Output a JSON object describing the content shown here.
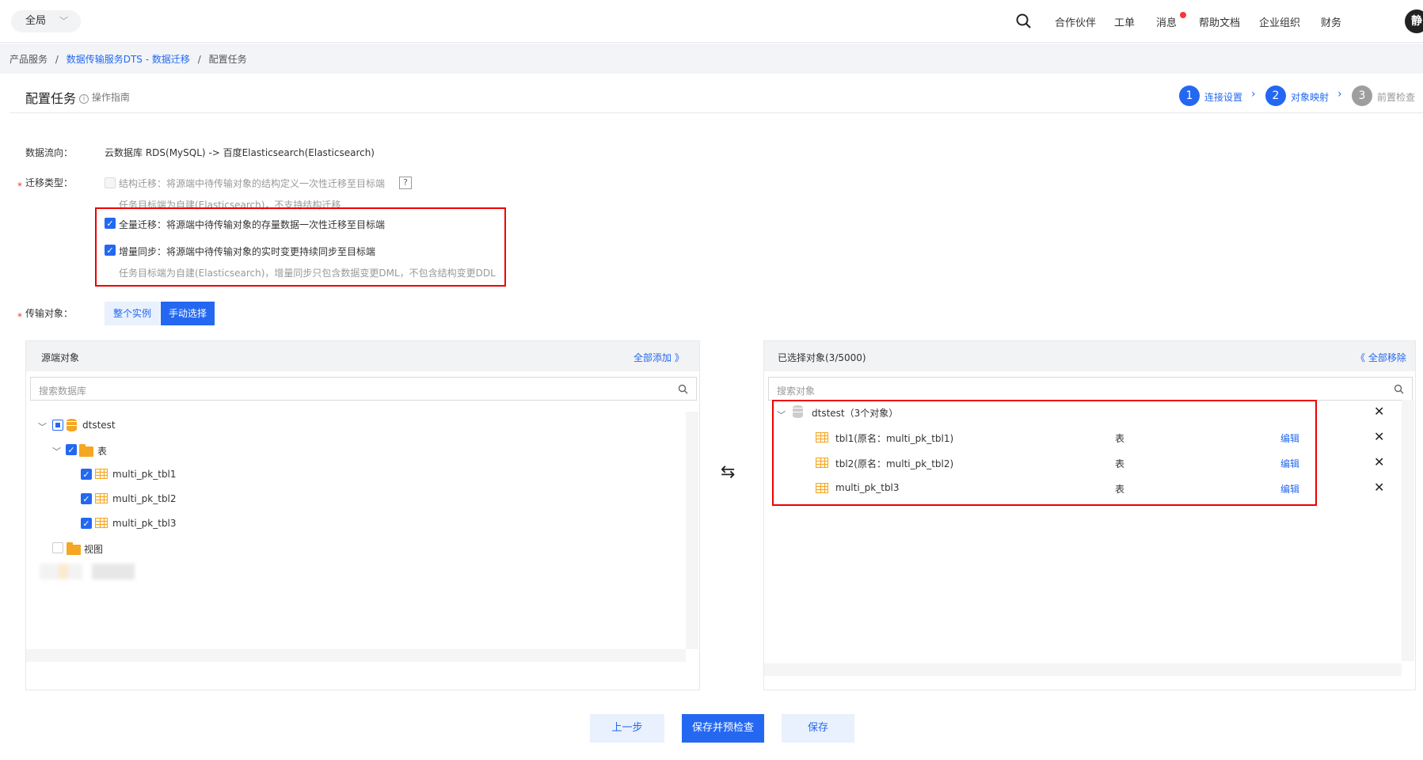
{
  "topbar": {
    "scope": "全局",
    "nav": [
      "合作伙伴",
      "工单",
      "消息",
      "帮助文档",
      "企业组织",
      "财务"
    ],
    "avatar": "静"
  },
  "breadcrumb": {
    "root": "产品服务",
    "sep": "/",
    "service": "数据传输服务DTS - 数据迁移",
    "current": "配置任务"
  },
  "page": {
    "title": "配置任务",
    "guide": "操作指南"
  },
  "steps": [
    {
      "num": "1",
      "label": "连接设置",
      "state": "active"
    },
    {
      "num": "2",
      "label": "对象映射",
      "state": "active"
    },
    {
      "num": "3",
      "label": "前置检查",
      "state": "inactive"
    }
  ],
  "form": {
    "flow_label": "数据流向：",
    "flow_value": "云数据库 RDS(MySQL) -> 百度Elasticsearch(Elasticsearch)",
    "type_label": "迁移类型：",
    "struct_option": "结构迁移：将源端中待传输对象的结构定义一次性迁移至目标端",
    "struct_hint": "任务目标端为自建(Elasticsearch)，不支持结构迁移",
    "qmark": "?",
    "full_option": "全量迁移：将源端中待传输对象的存量数据一次性迁移至目标端",
    "incr_option": "增量同步：将源端中待传输对象的实时变更持续同步至目标端",
    "incr_hint": "任务目标端为自建(Elasticsearch)，增量同步只包含数据变更DML，不包含结构变更DDL",
    "object_label": "传输对象：",
    "seg_whole": "整个实例",
    "seg_manual": "手动选择",
    "required_mark": "*"
  },
  "source": {
    "title": "源端对象",
    "add_all": "全部添加 》",
    "search_placeholder": "搜索数据库",
    "db": "dtstest",
    "table_folder": "表",
    "tables": [
      "multi_pk_tbl1",
      "multi_pk_tbl2",
      "multi_pk_tbl3"
    ],
    "view_folder": "视图"
  },
  "transfer_icon": "⇆",
  "selected": {
    "title": "已选择对象(3/5000)",
    "remove_all": "《 全部移除",
    "search_placeholder": "搜索对象",
    "db": "dtstest（3个对象）",
    "rows": [
      {
        "name": "tbl1(原名：multi_pk_tbl1)",
        "type": "表",
        "action": "编辑"
      },
      {
        "name": "tbl2(原名：multi_pk_tbl2)",
        "type": "表",
        "action": "编辑"
      },
      {
        "name": "multi_pk_tbl3",
        "type": "表",
        "action": "编辑"
      }
    ]
  },
  "footer": {
    "prev": "上一步",
    "save_check": "保存并预检查",
    "save": "保存"
  },
  "colors": {
    "primary": "#2468f2",
    "light_btn": "#e8f1fd",
    "highlight_border": "#e00000",
    "step_inactive": "#9e9e9e"
  }
}
